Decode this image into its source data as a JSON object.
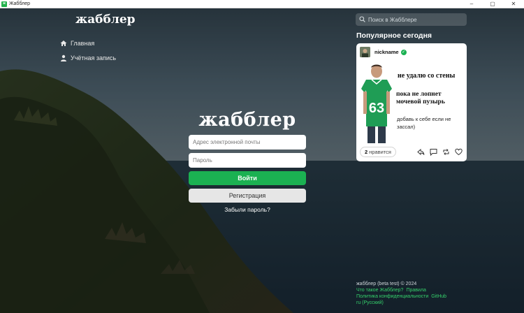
{
  "window": {
    "title": "Жабблер",
    "app_icon_letter": "ж",
    "controls": {
      "minimize": "–",
      "maximize": "▢",
      "close": "✕"
    }
  },
  "colors": {
    "accent": "#1bb152",
    "link": "#35d06b",
    "card": "#ffffff"
  },
  "sidebar": {
    "logo": "жабблер",
    "items": [
      {
        "label": "Главная",
        "icon": "home-icon"
      },
      {
        "label": "Учётная запись",
        "icon": "user-icon"
      }
    ]
  },
  "login": {
    "logo": "жабблер",
    "email_placeholder": "Адрес электронной почты",
    "password_placeholder": "Пароль",
    "login_label": "Войти",
    "register_label": "Регистрация",
    "forgot_label": "Забыли пароль?"
  },
  "search": {
    "placeholder": "Поиск в Жабблере",
    "icon": "search-icon"
  },
  "popular": {
    "title": "Популярное сегодня",
    "post": {
      "username": "nickname",
      "verified_icon": "check-icon",
      "meme_lines": {
        "line1": "не удалю со стены",
        "line2a": "пока не лопнет",
        "line2b": "мочевой пузырь",
        "line3a": "добавь к себе если не",
        "line3b": "зассал)"
      },
      "jersey_number": "63",
      "likes_count": "2",
      "likes_label": "нравится",
      "actions": [
        "share-icon",
        "comment-icon",
        "repost-icon",
        "heart-icon"
      ]
    }
  },
  "footer": {
    "copyright": "жабблер (beta test) © 2024",
    "links": {
      "about": "Что такое Жабблер?",
      "rules": "Правила",
      "privacy": "Политика конфиденциальности",
      "github": "GitHub",
      "language": "ru (Русский)"
    }
  }
}
